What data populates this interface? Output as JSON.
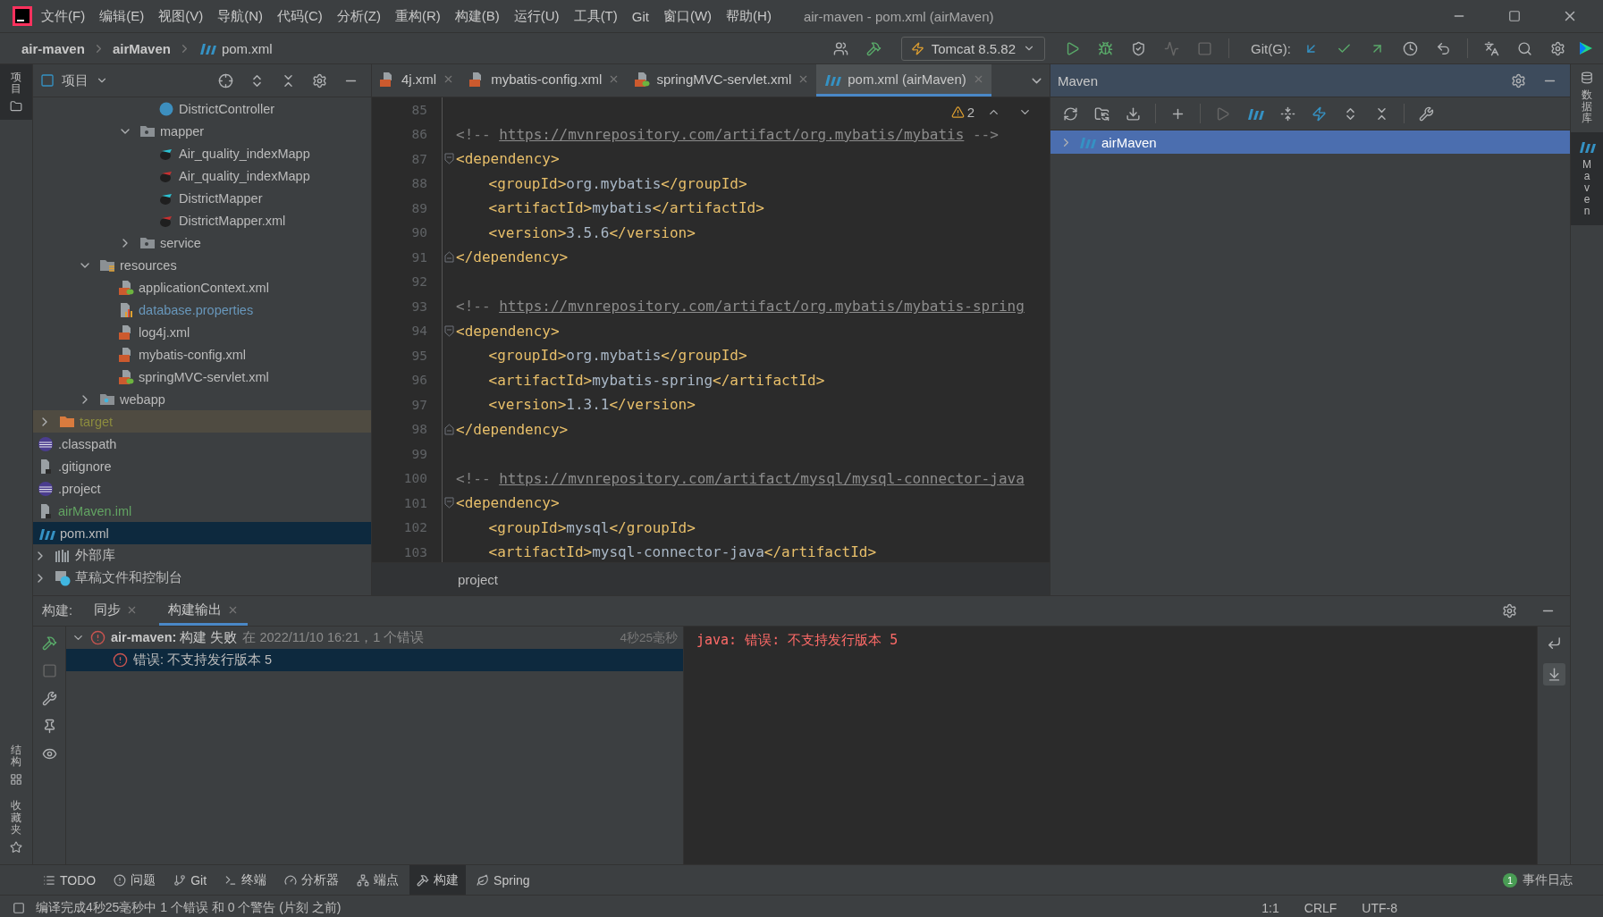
{
  "window": {
    "title": "air-maven - pom.xml (airMaven)"
  },
  "menu": [
    "文件(F)",
    "编辑(E)",
    "视图(V)",
    "导航(N)",
    "代码(C)",
    "分析(Z)",
    "重构(R)",
    "构建(B)",
    "运行(U)",
    "工具(T)",
    "Git",
    "窗口(W)",
    "帮助(H)"
  ],
  "breadcrumb": [
    {
      "label": "air-maven",
      "kind": "project"
    },
    {
      "label": "airMaven",
      "kind": "module"
    },
    {
      "label": "pom.xml",
      "kind": "maven"
    }
  ],
  "toolbar": {
    "run_config": "Tomcat 8.5.82",
    "git_label": "Git(G):"
  },
  "left_strip": [
    {
      "label": "项目",
      "selected": true
    },
    {
      "label": "结构",
      "selected": false
    },
    {
      "label": "收藏夹",
      "selected": false
    }
  ],
  "right_strip": [
    {
      "label": "数据库",
      "selected": false
    },
    {
      "label": "Maven",
      "selected": true
    }
  ],
  "project": {
    "title": "项目",
    "tree": [
      {
        "children": [
          {
            "children": [
              {
                "children": [
                  {
                    "children": [
                      {
                        "label": "DistrictController",
                        "kind": "class",
                        "selected": false
                      }
                    ]
                  },
                  {
                    "label": "mapper",
                    "kind": "folder",
                    "expanded": true,
                    "selected": false,
                    "children": [
                      {
                        "label": "Air_quality_indexMapp",
                        "kind": "mybatis_java",
                        "selected": false
                      },
                      {
                        "label": "Air_quality_indexMapp",
                        "kind": "mybatis_xml",
                        "selected": false
                      },
                      {
                        "label": "DistrictMapper",
                        "kind": "mybatis_java",
                        "selected": false
                      },
                      {
                        "label": "DistrictMapper.xml",
                        "kind": "mybatis_xml",
                        "selected": false
                      }
                    ]
                  },
                  {
                    "label": "service",
                    "kind": "folder",
                    "expanded": false,
                    "selected": false
                  }
                ]
              },
              {
                "label": "resources",
                "kind": "resources_folder",
                "expanded": true,
                "selected": false,
                "children": [
                  {
                    "label": "applicationContext.xml",
                    "kind": "spring_xml",
                    "selected": false
                  },
                  {
                    "label": "database.properties",
                    "kind": "properties",
                    "selected": false,
                    "color": "#6897bb"
                  },
                  {
                    "label": "log4j.xml",
                    "kind": "xml",
                    "selected": false
                  },
                  {
                    "label": "mybatis-config.xml",
                    "kind": "xml",
                    "selected": false
                  },
                  {
                    "label": "springMVC-servlet.xml",
                    "kind": "spring_xml",
                    "selected": false
                  }
                ]
              },
              {
                "label": "webapp",
                "kind": "web_folder",
                "expanded": false,
                "selected": false
              }
            ]
          },
          {
            "label": "target",
            "kind": "excluded_folder",
            "expanded": false,
            "selected": false,
            "color": "#8c8c3e"
          },
          {
            "label": ".classpath",
            "kind": "eclipse",
            "selected": false
          },
          {
            "label": ".gitignore",
            "kind": "ignore",
            "selected": false
          },
          {
            "label": ".project",
            "kind": "eclipse",
            "selected": false
          },
          {
            "label": "airMaven.iml",
            "kind": "iml",
            "selected": false,
            "color": "#62a362"
          },
          {
            "label": "pom.xml",
            "kind": "maven",
            "selected": true
          }
        ]
      },
      {
        "label": "外部库",
        "kind": "library",
        "expanded": false,
        "selected": false
      },
      {
        "label": "草稿文件和控制台",
        "kind": "scratch",
        "expanded": false,
        "selected": false
      }
    ]
  },
  "editor": {
    "tabs": [
      {
        "label": "4j.xml",
        "kind": "xml",
        "selected": false
      },
      {
        "label": "mybatis-config.xml",
        "kind": "xml",
        "selected": false
      },
      {
        "label": "springMVC-servlet.xml",
        "kind": "spring_xml",
        "selected": false
      },
      {
        "label": "pom.xml (airMaven)",
        "kind": "maven",
        "selected": true
      }
    ],
    "warnings": "2",
    "lines": [
      {
        "number": "85"
      },
      {
        "number": "86",
        "segments": [
          {
            "kind": "comment",
            "text": "<!-- "
          },
          {
            "kind": "link",
            "text": "https://mvnrepository.com/artifact/org.mybatis/mybatis"
          },
          {
            "kind": "comment",
            "text": " -->"
          }
        ]
      },
      {
        "number": "87",
        "fold_open": true,
        "segments": [
          {
            "kind": "tag",
            "text": "<dependency>"
          }
        ]
      },
      {
        "number": "88",
        "indent": true,
        "segments": [
          {
            "kind": "tag",
            "text": "<groupId>"
          },
          {
            "kind": "text",
            "text": "org.mybatis"
          },
          {
            "kind": "tag",
            "text": "</groupId>"
          }
        ]
      },
      {
        "number": "89",
        "indent": true,
        "segments": [
          {
            "kind": "tag",
            "text": "<artifactId>"
          },
          {
            "kind": "text",
            "text": "mybatis"
          },
          {
            "kind": "tag",
            "text": "</artifactId>"
          }
        ]
      },
      {
        "number": "90",
        "indent": true,
        "segments": [
          {
            "kind": "tag",
            "text": "<version>"
          },
          {
            "kind": "text",
            "text": "3.5.6"
          },
          {
            "kind": "tag",
            "text": "</version>"
          }
        ]
      },
      {
        "number": "91",
        "fold_close": true,
        "segments": [
          {
            "kind": "tag",
            "text": "</dependency>"
          }
        ]
      },
      {
        "number": "92"
      },
      {
        "number": "93",
        "segments": [
          {
            "kind": "comment",
            "text": "<!-- "
          },
          {
            "kind": "link",
            "text": "https://mvnrepository.com/artifact/org.mybatis/mybatis-spring"
          }
        ]
      },
      {
        "number": "94",
        "fold_open": true,
        "segments": [
          {
            "kind": "tag",
            "text": "<dependency>"
          }
        ]
      },
      {
        "number": "95",
        "indent": true,
        "segments": [
          {
            "kind": "tag",
            "text": "<groupId>"
          },
          {
            "kind": "text",
            "text": "org.mybatis"
          },
          {
            "kind": "tag",
            "text": "</groupId>"
          }
        ]
      },
      {
        "number": "96",
        "indent": true,
        "segments": [
          {
            "kind": "tag",
            "text": "<artifactId>"
          },
          {
            "kind": "text",
            "text": "mybatis-spring"
          },
          {
            "kind": "tag",
            "text": "</artifactId>"
          }
        ]
      },
      {
        "number": "97",
        "indent": true,
        "segments": [
          {
            "kind": "tag",
            "text": "<version>"
          },
          {
            "kind": "text",
            "text": "1.3.1"
          },
          {
            "kind": "tag",
            "text": "</version>"
          }
        ]
      },
      {
        "number": "98",
        "fold_close": true,
        "segments": [
          {
            "kind": "tag",
            "text": "</dependency>"
          }
        ]
      },
      {
        "number": "99"
      },
      {
        "number": "100",
        "segments": [
          {
            "kind": "comment",
            "text": "<!-- "
          },
          {
            "kind": "link",
            "text": "https://mvnrepository.com/artifact/mysql/mysql-connector-java"
          }
        ]
      },
      {
        "number": "101",
        "fold_open": true,
        "segments": [
          {
            "kind": "tag",
            "text": "<dependency>"
          }
        ]
      },
      {
        "number": "102",
        "indent": true,
        "segments": [
          {
            "kind": "tag",
            "text": "<groupId>"
          },
          {
            "kind": "text",
            "text": "mysql"
          },
          {
            "kind": "tag",
            "text": "</groupId>"
          }
        ]
      },
      {
        "number": "103",
        "indent": true,
        "segments": [
          {
            "kind": "tag",
            "text": "<artifactId>"
          },
          {
            "kind": "text",
            "text": "mysql-connector-java"
          },
          {
            "kind": "tag",
            "text": "</artifactId>"
          }
        ]
      }
    ],
    "breadcrumb": "project"
  },
  "maven": {
    "title": "Maven",
    "tree": [
      {
        "label": "airMaven",
        "selected": true,
        "expanded": false
      }
    ]
  },
  "build": {
    "label": "构建:",
    "tabs": [
      {
        "label": "同步",
        "selected": false
      },
      {
        "label": "构建输出",
        "selected": true
      }
    ],
    "tree": [
      {
        "title": "**air-maven:** 构建 失败",
        "detail": "在 2022/11/10 16:21，1 个错误",
        "time": "4秒25毫秒",
        "expanded": true,
        "selected": false,
        "children": [
          {
            "title": "错误: 不支持发行版本 5",
            "selected": true
          }
        ]
      }
    ],
    "output": "java: 错误: 不支持发行版本 5"
  },
  "tool_tabs": [
    {
      "label": "TODO",
      "kind": "todo",
      "selected": false
    },
    {
      "label": "问题",
      "kind": "problems",
      "selected": false
    },
    {
      "label": "Git",
      "kind": "git",
      "selected": false
    },
    {
      "label": "终端",
      "kind": "terminal",
      "selected": false
    },
    {
      "label": "分析器",
      "kind": "profiler",
      "selected": false
    },
    {
      "label": "端点",
      "kind": "endpoints",
      "selected": false
    },
    {
      "label": "构建",
      "kind": "build",
      "selected": true
    },
    {
      "label": "Spring",
      "kind": "spring",
      "selected": false
    }
  ],
  "event_log": {
    "label": "事件日志",
    "count": "1"
  },
  "status_bar": {
    "message": "编译完成4秒25毫秒中 1 个错误 和 0 个警告 (片刻 之前)",
    "items": [
      "1:1",
      "CRLF",
      "UTF-8"
    ]
  }
}
